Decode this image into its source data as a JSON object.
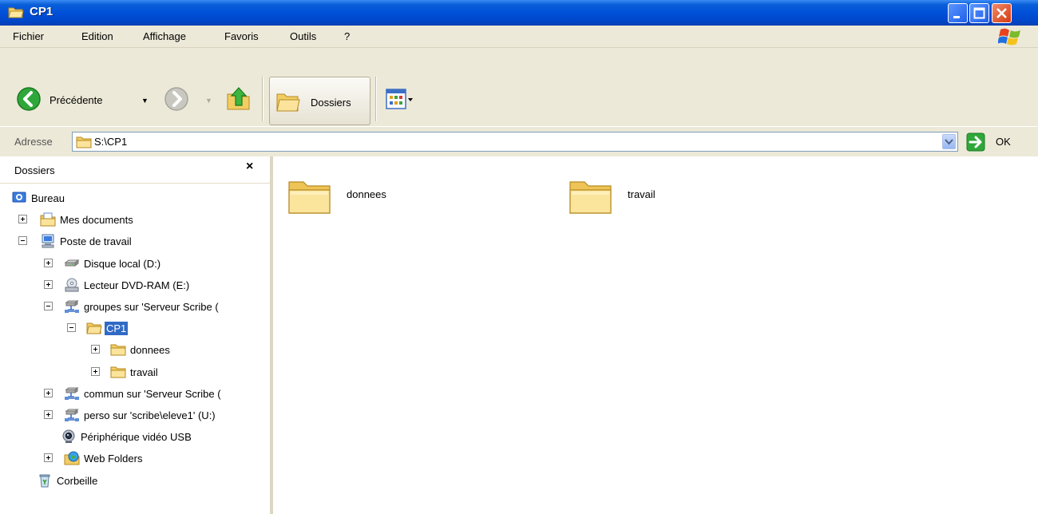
{
  "window": {
    "title": "CP1",
    "controls": [
      "minimize",
      "maximize",
      "close"
    ]
  },
  "menubar": {
    "items": [
      "Fichier",
      "Edition",
      "Affichage",
      "Favoris",
      "Outils",
      "?"
    ]
  },
  "toolbar": {
    "back_label": "Précédente",
    "folders_label": "Dossiers"
  },
  "address": {
    "label": "Adresse",
    "value": "S:\\CP1",
    "go_label": "OK"
  },
  "folders_pane": {
    "title": "Dossiers",
    "close": "×",
    "tree": [
      {
        "label": "Bureau",
        "icon": "desktop-icon",
        "level": 0,
        "expander": "none"
      },
      {
        "label": "Mes documents",
        "icon": "my-documents-icon",
        "level": 1,
        "expander": "plus"
      },
      {
        "label": "Poste de travail",
        "icon": "my-computer-icon",
        "level": 1,
        "expander": "minus"
      },
      {
        "label": "Disque local (D:)",
        "icon": "hard-drive-icon",
        "level": 2,
        "expander": "plus"
      },
      {
        "label": "Lecteur DVD-RAM (E:)",
        "icon": "dvd-drive-icon",
        "level": 2,
        "expander": "plus"
      },
      {
        "label": "groupes sur 'Serveur Scribe (",
        "icon": "network-drive-icon",
        "level": 2,
        "expander": "minus"
      },
      {
        "label": "CP1",
        "icon": "open-folder-icon",
        "level": 3,
        "expander": "minus",
        "selected": true
      },
      {
        "label": "donnees",
        "icon": "folder-icon",
        "level": 4,
        "expander": "plus"
      },
      {
        "label": "travail",
        "icon": "folder-icon",
        "level": 4,
        "expander": "plus"
      },
      {
        "label": "commun sur 'Serveur Scribe (",
        "icon": "network-drive-icon",
        "level": 2,
        "expander": "plus"
      },
      {
        "label": "perso sur 'scribe\\eleve1' (U:)",
        "icon": "network-drive-icon",
        "level": 2,
        "expander": "plus"
      },
      {
        "label": "Périphérique vidéo USB",
        "icon": "webcam-icon",
        "level": 2,
        "expander": "none"
      },
      {
        "label": "Web Folders",
        "icon": "web-folders-icon",
        "level": 2,
        "expander": "plus"
      },
      {
        "label": "Corbeille",
        "icon": "recycle-bin-icon",
        "level": 1,
        "expander": "none"
      }
    ]
  },
  "content": {
    "items": [
      {
        "label": "donnees",
        "icon": "folder-icon"
      },
      {
        "label": "travail",
        "icon": "folder-icon"
      }
    ]
  }
}
